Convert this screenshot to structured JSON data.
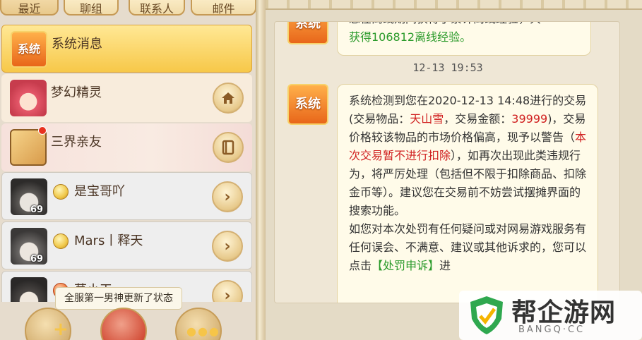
{
  "tabs": {
    "recent": "最近",
    "chat": "聊组",
    "contacts": "联系人",
    "mail": "邮件"
  },
  "contacts": [
    {
      "name": "系统消息",
      "icon_text": "系统",
      "action_icon": ""
    },
    {
      "name": "梦幻精灵",
      "action_icon": "home-icon"
    },
    {
      "name": "三界亲友",
      "action_icon": "book-icon"
    },
    {
      "name": "是宝哥吖",
      "level": "69",
      "action_icon": "chevron-right-icon"
    },
    {
      "name": "Mars丨释天",
      "level": "69",
      "action_icon": "chevron-right-icon"
    },
    {
      "name": "莫小天",
      "action_icon": "chevron-right-icon"
    }
  ],
  "tooltip": "全服第一男神更新了状态",
  "chat": {
    "sys_icon_text": "系统",
    "msg1_line1": "您在离线期间获得了累计离线经验，共",
    "msg1_line2": "获得106812离线经验。",
    "timestamp": "12-13  19:53",
    "msg2": {
      "p1": "系统检测到您在2020-12-13 14:48进行的交易(交易物品：",
      "item": "天山雪",
      "p2": "，交易金额：",
      "amount": "39999",
      "p3": ")，交易价格较该物品的市场价格偏高，现予以警告（",
      "warn": "本次交易暂不进行扣除",
      "p4": "），如再次出现此类违规行为，将严厉处理（包括但不限于扣除商品、扣除金币等）。建议您在交易前不妨尝试摆摊界面的搜索功能。",
      "p5": "如您对本次处罚有任何疑问或对网易游戏服务有任何误会、不满意、建议或其他诉求的，您可以点击",
      "link": "【处罚申诉】",
      "p6": "进"
    }
  },
  "watermark": {
    "title": "帮企游网",
    "sub": "BANGQ·CC"
  },
  "colors": {
    "selected_row": "#f7c849",
    "warning_red": "#d02020",
    "exp_green": "#2a9a2a"
  }
}
